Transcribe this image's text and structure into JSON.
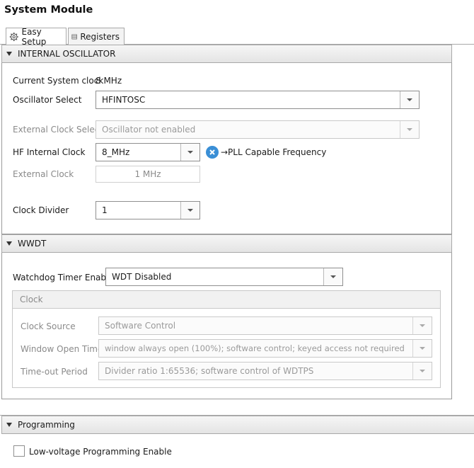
{
  "window": {
    "title": "System Module"
  },
  "tabs": [
    {
      "label": "Easy Setup",
      "icon": "gear-icon",
      "active": true
    },
    {
      "label": "Registers",
      "icon": "table-icon",
      "active": false
    }
  ],
  "oscillator": {
    "header": "INTERNAL OSCILLATOR",
    "current_clock_label": "Current System clock",
    "current_clock_value": "8 MHz",
    "osc_select_label": "Oscillator Select",
    "osc_select_value": "HFINTOSC",
    "ext_clock_select_label": "External Clock Select",
    "ext_clock_select_value": "Oscillator not enabled",
    "hf_clock_label": "HF Internal Clock",
    "hf_clock_value": "8_MHz",
    "pll_note": "→PLL Capable Frequency",
    "ext_clock_label": "External Clock",
    "ext_clock_value": "1 MHz",
    "clock_divider_label": "Clock Divider",
    "clock_divider_value": "1"
  },
  "wwdt": {
    "header": "WWDT",
    "enable_label": "Watchdog Timer Enable",
    "enable_value": "WDT Disabled",
    "clock_group": {
      "header": "Clock",
      "source_label": "Clock Source",
      "source_value": "Software Control",
      "window_label": "Window Open Time",
      "window_value": "window always open (100%); software control; keyed access not required",
      "timeout_label": "Time-out Period",
      "timeout_value": "Divider ratio 1:65536; software control of WDTPS"
    }
  },
  "programming": {
    "header": "Programming",
    "lvp_label": "Low-voltage Programming Enable",
    "lvp_checked": false
  },
  "colors": {
    "info_icon": "#3a8fd6",
    "header_border": "#a9a9a9",
    "disabled_text": "#8a8a8a"
  }
}
